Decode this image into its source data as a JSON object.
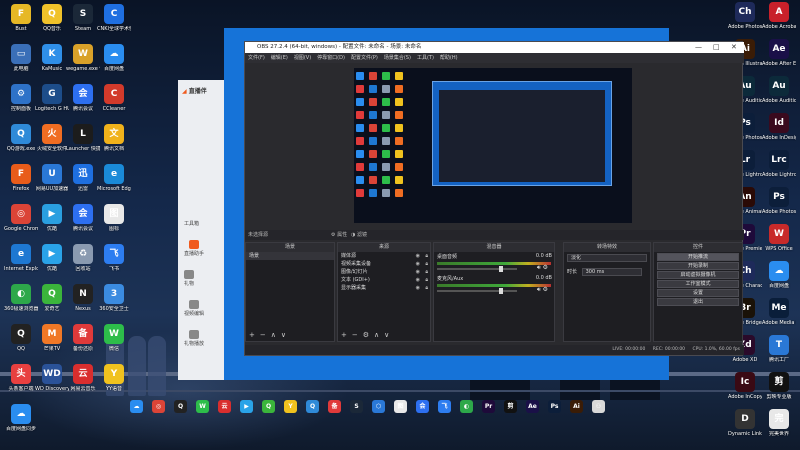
{
  "desktop": {
    "left_icons": [
      {
        "label": "Bust",
        "g": "F",
        "c": "#e6b826"
      },
      {
        "label": "QQ音乐",
        "g": "Q",
        "c": "#f0c22a"
      },
      {
        "label": "Steam",
        "g": "S",
        "c": "#1b2838"
      },
      {
        "label": "CNKI全球学术快报",
        "g": "C",
        "c": "#1f6fe0"
      },
      {
        "label": "此电脑",
        "g": "▭",
        "c": "#3a6fb8"
      },
      {
        "label": "KaMusic",
        "g": "K",
        "c": "#2f8fe8"
      },
      {
        "label": "wegame.exe 快捷方式",
        "g": "W",
        "c": "#d9a129"
      },
      {
        "label": "百度网盘",
        "g": "☁",
        "c": "#2a8df0"
      },
      {
        "label": "控制面板",
        "g": "⚙",
        "c": "#2e72c8"
      },
      {
        "label": "Logitech G HUB",
        "g": "G",
        "c": "#1d4d8a"
      },
      {
        "label": "腾讯会议",
        "g": "会",
        "c": "#2d6ff0"
      },
      {
        "label": "CCleaner",
        "g": "C",
        "c": "#d23a2b"
      },
      {
        "label": "QQ游戏.exe",
        "g": "Q",
        "c": "#2f8ad8"
      },
      {
        "label": "火绒安全软件",
        "g": "火",
        "c": "#f06d22"
      },
      {
        "label": "Launcher 快捷方式",
        "g": "L",
        "c": "#1c1c1c"
      },
      {
        "label": "腾讯文档",
        "g": "文",
        "c": "#f0b21b"
      },
      {
        "label": "Firefox",
        "g": "F",
        "c": "#e85c1a"
      },
      {
        "label": "网易UU加速器",
        "g": "U",
        "c": "#2a78d6"
      },
      {
        "label": "迅雷",
        "g": "迅",
        "c": "#1e6fe0"
      },
      {
        "label": "Microsoft Edge",
        "g": "e",
        "c": "#1a8ad8"
      },
      {
        "label": "Google Chrome",
        "g": "◎",
        "c": "#db4437"
      },
      {
        "label": "优酷",
        "g": "▶",
        "c": "#2a9fe0"
      },
      {
        "label": "腾讯会议",
        "g": "会",
        "c": "#2d6ff0"
      },
      {
        "label": "图标",
        "g": "图",
        "c": "#e8e8e8"
      },
      {
        "label": "Internet Explorer",
        "g": "e",
        "c": "#1e78d2"
      },
      {
        "label": "优酷",
        "g": "▶",
        "c": "#2aa3e8"
      },
      {
        "label": "回收站",
        "g": "♻",
        "c": "#8a9ab0"
      },
      {
        "label": "飞书",
        "g": "飞",
        "c": "#2d7df0"
      },
      {
        "label": "360极速浏览器",
        "g": "◐",
        "c": "#2da84a"
      },
      {
        "label": "爱奇艺",
        "g": "Q",
        "c": "#3bb53b"
      },
      {
        "label": "Nexus",
        "g": "N",
        "c": "#222"
      },
      {
        "label": "360安全卫士",
        "g": "3",
        "c": "#3b8be0"
      },
      {
        "label": "QQ",
        "g": "Q",
        "c": "#222"
      },
      {
        "label": "芒果TV",
        "g": "M",
        "c": "#f07826"
      },
      {
        "label": "备份还原",
        "g": "备",
        "c": "#e03a3a"
      },
      {
        "label": "微信",
        "g": "W",
        "c": "#2dbd4a"
      },
      {
        "label": "头条客户端",
        "g": "头",
        "c": "#e84040"
      },
      {
        "label": "WD Discovery",
        "g": "WD",
        "c": "#2a5298"
      },
      {
        "label": "网易云音乐",
        "g": "云",
        "c": "#d92e2e"
      },
      {
        "label": "YY语音",
        "g": "Y",
        "c": "#f0c21e"
      },
      {
        "label": "百度网盘同步",
        "g": "☁",
        "c": "#2a8df0"
      }
    ],
    "right_icons": [
      {
        "label": "Adobe Photoshop",
        "g": "Ch",
        "c": "#1e2a5a"
      },
      {
        "label": "Adobe Acrobat DC",
        "g": "A",
        "c": "#c8202a"
      },
      {
        "label": "Adobe Illustrator",
        "g": "Ai",
        "c": "#3a1c06"
      },
      {
        "label": "Adobe After Effects 2020",
        "g": "Ae",
        "c": "#1a1048"
      },
      {
        "label": "Adobe Audition",
        "g": "Au",
        "c": "#0c2a3a"
      },
      {
        "label": "Adobe Audition 2020",
        "g": "Au",
        "c": "#0c2a3a"
      },
      {
        "label": "Adobe Photoshop",
        "g": "Ps",
        "c": "#0c1e3a"
      },
      {
        "label": "Adobe InDesign",
        "g": "Id",
        "c": "#3a0a1e"
      },
      {
        "label": "Adobe Lightroom",
        "g": "Lr",
        "c": "#0c1e3a"
      },
      {
        "label": "Adobe Lightroom Classic",
        "g": "Lrc",
        "c": "#0c1e3a"
      },
      {
        "label": "Adobe Animate",
        "g": "An",
        "c": "#2a0a06"
      },
      {
        "label": "Adobe Photoshop 2020",
        "g": "Ps",
        "c": "#0c1e3a"
      },
      {
        "label": "Adobe Premiere",
        "g": "Pr",
        "c": "#1e0a3a"
      },
      {
        "label": "WPS Office",
        "g": "W",
        "c": "#c82a2a"
      },
      {
        "label": "Adobe Character",
        "g": "Ch",
        "c": "#1e2a5a"
      },
      {
        "label": "百度网盘",
        "g": "☁",
        "c": "#2a8df0"
      },
      {
        "label": "Adobe Bridge",
        "g": "Br",
        "c": "#1a1208"
      },
      {
        "label": "Adobe Media Encoder",
        "g": "Me",
        "c": "#0a1e3a"
      },
      {
        "label": "Adobe XD",
        "g": "Xd",
        "c": "#2a0a2a"
      },
      {
        "label": "腾讯工厂",
        "g": "T",
        "c": "#2a78d6"
      },
      {
        "label": "Adobe InCopy",
        "g": "Ic",
        "c": "#3a0a14"
      },
      {
        "label": "剪映专业版",
        "g": "剪",
        "c": "#111"
      },
      {
        "label": "Dynamic Link",
        "g": "D",
        "c": "#333"
      },
      {
        "label": "完美世界",
        "g": "完",
        "c": "#e8e8e8"
      }
    ]
  },
  "taskbar": [
    {
      "g": "☁",
      "c": "#2a8df0"
    },
    {
      "g": "◎",
      "c": "#db4437"
    },
    {
      "g": "Q",
      "c": "#222"
    },
    {
      "g": "W",
      "c": "#2dbd4a"
    },
    {
      "g": "云",
      "c": "#d92e2e"
    },
    {
      "g": "▶",
      "c": "#2aa3e8"
    },
    {
      "g": "Q",
      "c": "#3bb53b"
    },
    {
      "g": "Y",
      "c": "#f0c21e"
    },
    {
      "g": "Q",
      "c": "#2f8ad8"
    },
    {
      "g": "备",
      "c": "#e03a3a"
    },
    {
      "g": "S",
      "c": "#1b2838"
    },
    {
      "g": "⬡",
      "c": "#2a78d6"
    },
    {
      "g": "图",
      "c": "#e8e8e8"
    },
    {
      "g": "会",
      "c": "#2d6ff0"
    },
    {
      "g": "飞",
      "c": "#2d7df0"
    },
    {
      "g": "◐",
      "c": "#2da84a"
    },
    {
      "g": "Pr",
      "c": "#1e0a3a"
    },
    {
      "g": "剪",
      "c": "#111"
    },
    {
      "g": "Ae",
      "c": "#1a1048"
    },
    {
      "g": "Ps",
      "c": "#0c1e3a"
    },
    {
      "g": "Ai",
      "c": "#3a1c06"
    },
    {
      "g": "⚇",
      "c": "#d8d8d8"
    }
  ],
  "zhibo": {
    "logo": "直播伴",
    "nav": [
      "工具箱",
      "直播助手",
      "礼物",
      "视频编辑",
      "礼物播放"
    ]
  },
  "obs": {
    "title": "OBS 27.2.4 (64-bit, windows) - 配置文件: 未命名 - 场景: 未命名",
    "menu": [
      "文件(F)",
      "编辑(E)",
      "视图(V)",
      "停靠窗口(D)",
      "配置文件(P)",
      "场景集合(S)",
      "工具(T)",
      "帮助(H)"
    ],
    "scene_bar": "未选择源",
    "scene_tabs": [
      "属性",
      "滤镜"
    ],
    "panels": {
      "scenes": {
        "header": "场景",
        "items": [
          "场景"
        ]
      },
      "sources": {
        "header": "来源",
        "items": [
          "媒体源",
          "视频采集设备",
          "图像/幻灯片",
          "文本 (GDI+)",
          "显示器采集"
        ]
      },
      "mixer": {
        "header": "混音器",
        "tracks": [
          {
            "name": "桌面音频",
            "level": "0.0 dB",
            "vol": 0.82
          },
          {
            "name": "麦克风/Aux",
            "level": "0.0 dB",
            "vol": 0.82
          }
        ]
      },
      "transitions": {
        "header": "转场特效",
        "type": "淡化",
        "duration_label": "时长",
        "duration": "300 ms"
      },
      "controls": {
        "header": "控件",
        "buttons": [
          "开始推流",
          "开始录制",
          "启动虚拟摄像机",
          "工作室模式",
          "设置",
          "退出"
        ]
      }
    },
    "status": {
      "live": "LIVE: 00:00:00",
      "rec": "REC: 00:00:00",
      "cpu": "CPU: 1.0%, 60.00 fps"
    }
  }
}
